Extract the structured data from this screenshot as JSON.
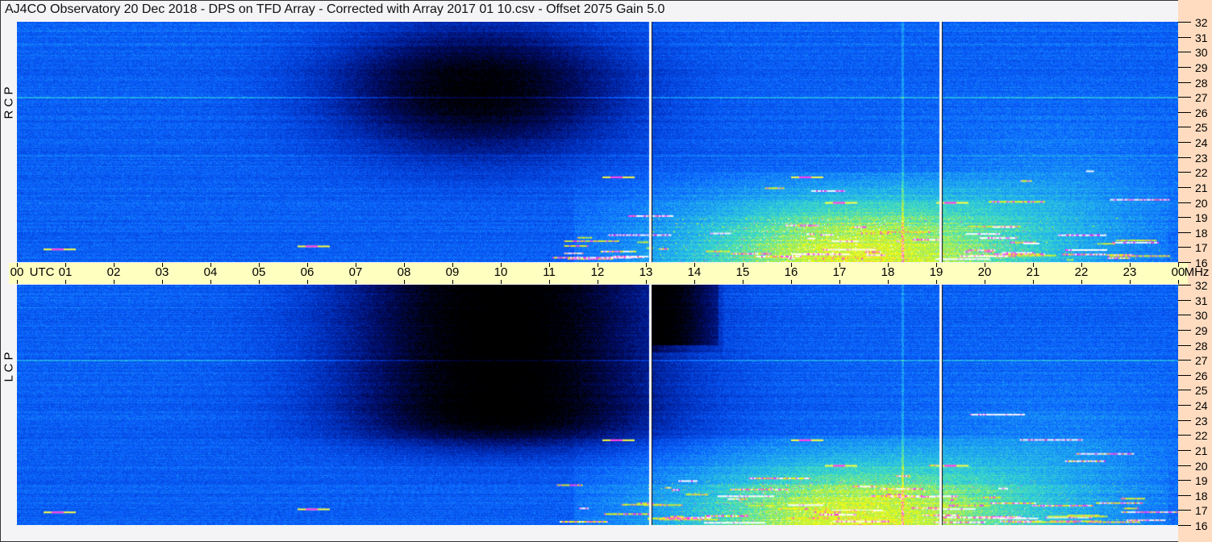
{
  "title": "AJ4CO Observatory  20 Dec 2018  -  DPS on TFD Array  -  Corrected with Array 2017 01 10.csv  -  Offset 2075  Gain 5.0",
  "chart_data": {
    "type": "heatmap",
    "title": "AJ4CO Observatory  20 Dec 2018  -  DPS on TFD Array  -  Corrected with Array 2017 01 10.csv  -  Offset 2075  Gain 5.0",
    "xlabel": "UTC",
    "ylabel": "MHz",
    "x_range_hours": [
      0,
      24
    ],
    "y_range_mhz": [
      16,
      32
    ],
    "x_ticks": [
      "00",
      "01",
      "02",
      "03",
      "04",
      "05",
      "06",
      "07",
      "08",
      "09",
      "10",
      "11",
      "12",
      "13",
      "14",
      "15",
      "16",
      "17",
      "18",
      "19",
      "20",
      "21",
      "22",
      "23",
      "00"
    ],
    "y_ticks": [
      "32",
      "31",
      "30",
      "29",
      "28",
      "27",
      "26",
      "25",
      "24",
      "23",
      "22",
      "21",
      "20",
      "19",
      "18",
      "17",
      "16"
    ],
    "panels": [
      {
        "name": "RCP",
        "label": "R C P"
      },
      {
        "name": "LCP",
        "label": "L C P"
      }
    ],
    "data_gaps_utc_hours": [
      13.1,
      19.1
    ],
    "colormap": [
      "#000000",
      "#000a60",
      "#0030c0",
      "#0a60ff",
      "#20b0f0",
      "#40e0c0",
      "#c0f040",
      "#ffff00",
      "#ff20ff",
      "#ffffff"
    ]
  },
  "axis": {
    "utc_label": "UTC",
    "mhz_label": "MHz"
  }
}
